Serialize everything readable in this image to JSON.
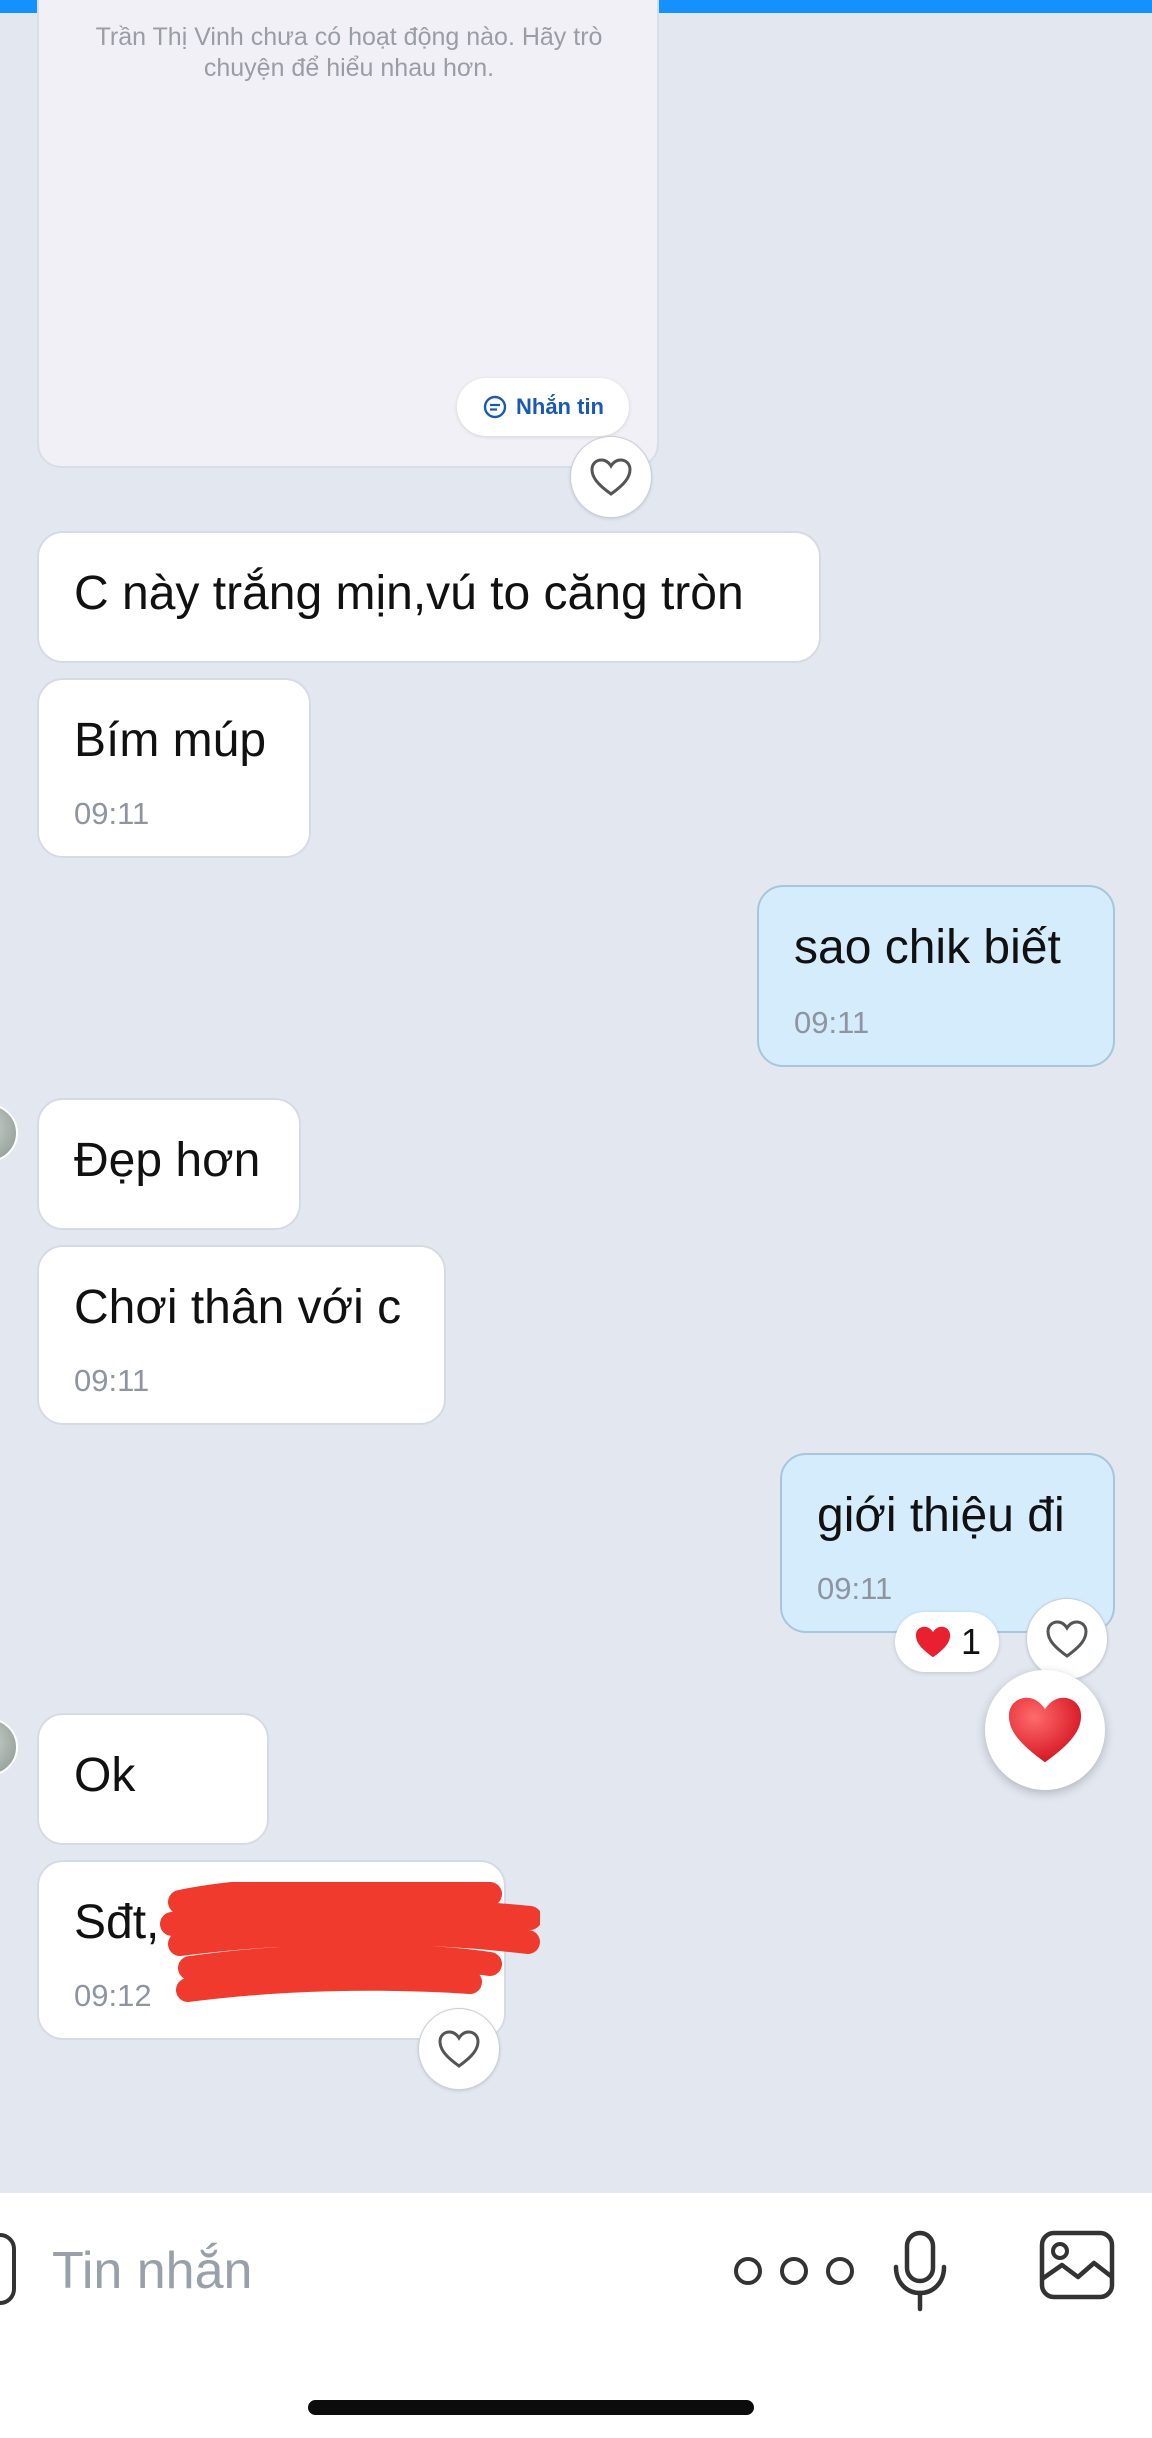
{
  "card": {
    "text": "Trần Thị Vinh chưa có hoạt động nào. Hãy trò chuyện để hiểu nhau hơn.",
    "button_label": "Nhắn tin"
  },
  "messages": [
    {
      "side": "in",
      "text": "C này trắng mịn,vú to căng tròn",
      "time": ""
    },
    {
      "side": "in",
      "text": "Bím múp",
      "time": "09:11"
    },
    {
      "side": "out",
      "text": "sao chik biết",
      "time": "09:11"
    },
    {
      "side": "in",
      "text": "Đẹp hơn",
      "time": ""
    },
    {
      "side": "in",
      "text": "Chơi thân với c",
      "time": "09:11"
    },
    {
      "side": "out",
      "text": "giới thiệu đi",
      "time": "09:11"
    },
    {
      "side": "in",
      "text": "Ok",
      "time": ""
    },
    {
      "side": "in",
      "text": "Sđt,",
      "time": "09:12"
    }
  ],
  "reaction": {
    "emoji": "❤️",
    "count": "1"
  },
  "composer": {
    "placeholder": "Tin nhắn"
  },
  "colors": {
    "accent": "#1591ff",
    "incoming_bubble": "#ffffff",
    "outgoing_bubble": "#d4ecfb",
    "chat_background": "#e2e7f0",
    "heart_red": "#e8202f"
  },
  "icons": [
    "chat-bubble-icon",
    "heart-outline-icon",
    "heart-filled-icon",
    "more-icon",
    "microphone-icon",
    "image-icon"
  ]
}
